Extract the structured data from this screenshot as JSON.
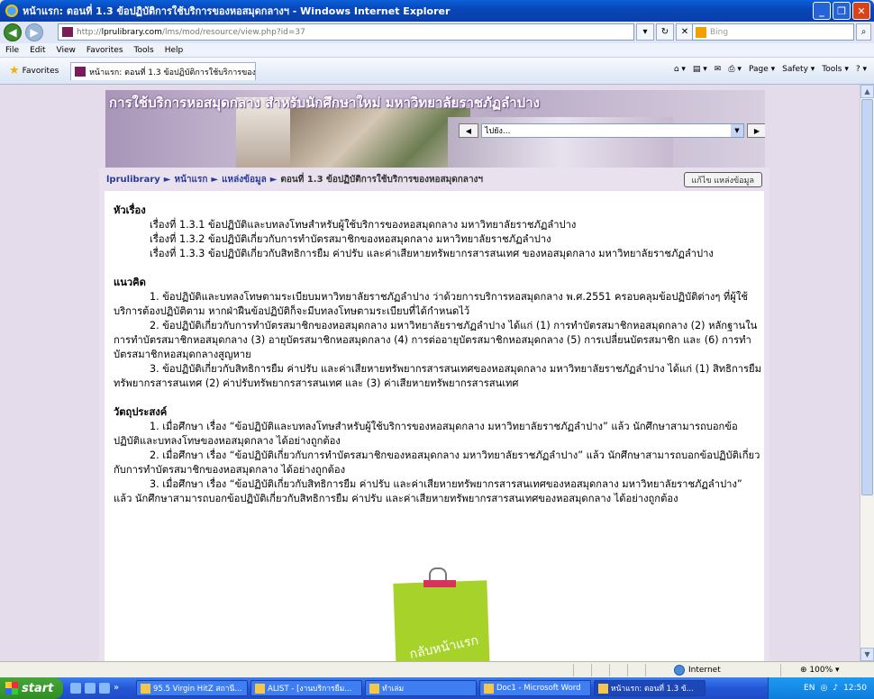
{
  "window": {
    "title": "หน้าแรก: ตอนที่ 1.3 ข้อปฏิบัติการใช้บริการของหอสมุดกลางฯ - Windows Internet Explorer"
  },
  "nav": {
    "url_prefix": "http://",
    "url_host": "lprulibrary.com",
    "url_path": "/lms/mod/resource/view.php?id=37",
    "search_placeholder": "Bing"
  },
  "menu": [
    "File",
    "Edit",
    "View",
    "Favorites",
    "Tools",
    "Help"
  ],
  "favorites": {
    "label": "Favorites",
    "tab_title": "หน้าแรก: ตอนที่ 1.3 ข้อปฏิบัติการใช้บริการของหอสมุด...",
    "commands": [
      "Page ▾",
      "Safety ▾",
      "Tools ▾"
    ]
  },
  "page": {
    "site_title": "การใช้บริการหอสมุดกลาง สำหรับนักศึกษาใหม่ มหาวิทยาลัยราชภัฏลำปาง",
    "jump_placeholder": "ไปยัง...",
    "breadcrumb": [
      "lprulibrary",
      "หน้าแรก",
      "แหล่งข้อมูล",
      "ตอนที่ 1.3 ข้อปฏิบัติการใช้บริการของหอสมุดกลางฯ"
    ],
    "edit_button": "แก้ไข แหล่งข้อมูล",
    "topics_heading": "หัวเรื่อง",
    "topics": [
      "เรื่องที่ 1.3.1 ข้อปฏิบัติและบทลงโทษสำหรับผู้ใช้บริการของหอสมุดกลาง มหาวิทยาลัยราชภัฏลำปาง",
      "เรื่องที่ 1.3.2 ข้อปฏิบัติเกี่ยวกับการทำบัตรสมาชิกของหอสมุดกลาง มหาวิทยาลัยราชภัฏลำปาง",
      "เรื่องที่ 1.3.3 ข้อปฏิบัติเกี่ยวกับสิทธิการยืม ค่าปรับ และค่าเสียหายทรัพยากรสารสนเทศ ของหอสมุดกลาง มหาวิทยาลัยราชภัฏลำปาง"
    ],
    "concept_heading": "แนวคิด",
    "concepts": [
      "1. ข้อปฏิบัติและบทลงโทษตามระเบียบมหาวิทยาลัยราชภัฏลำปาง ว่าด้วยการบริการหอสมุดกลาง พ.ศ.2551 ครอบคลุมข้อปฏิบัติต่างๆ ที่ผู้ใช้บริการต้องปฏิบัติตาม หากฝ่าฝืนข้อปฏิบัติก็จะมีบทลงโทษตามระเบียบที่ได้กำหนดไว้",
      "2. ข้อปฏิบัติเกี่ยวกับการทำบัตรสมาชิกของหอสมุดกลาง มหาวิทยาลัยราชภัฏลำปาง ได้แก่ (1) การทำบัตรสมาชิกหอสมุดกลาง (2) หลักฐานในการทำบัตรสมาชิกหอสมุดกลาง (3) อายุบัตรสมาชิกหอสมุดกลาง (4) การต่ออายุบัตรสมาชิกหอสมุดกลาง (5) การเปลี่ยนบัตรสมาชิก และ (6) การทำบัตรสมาชิกหอสมุดกลางสูญหาย",
      "3. ข้อปฏิบัติเกี่ยวกับสิทธิการยืม ค่าปรับ และค่าเสียหายทรัพยากรสารสนเทศของหอสมุดกลาง มหาวิทยาลัยราชภัฏลำปาง ได้แก่ (1) สิทธิการยืมทรัพยากรสารสนเทศ (2) ค่าปรับทรัพยากรสารสนเทศ และ (3) ค่าเสียหายทรัพยากรสารสนเทศ"
    ],
    "objective_heading": "วัตถุประสงค์",
    "objectives": [
      "1. เมื่อศึกษา เรื่อง “ข้อปฏิบัติและบทลงโทษสำหรับผู้ใช้บริการของหอสมุดกลาง มหาวิทยาลัยราชภัฏลำปาง” แล้ว นักศึกษาสามารถบอกข้อปฏิบัติและบทลงโทษของหอสมุดกลาง ได้อย่างถูกต้อง",
      "2. เมื่อศึกษา เรื่อง “ข้อปฏิบัติเกี่ยวกับการทำบัตรสมาชิกของหอสมุดกลาง มหาวิทยาลัยราชภัฏลำปาง” แล้ว นักศึกษาสามารถบอกข้อปฏิบัติเกี่ยวกับการทำบัตรสมาชิกของหอสมุดกลาง ได้อย่างถูกต้อง",
      "3. เมื่อศึกษา เรื่อง “ข้อปฏิบัติเกี่ยวกับสิทธิการยืม ค่าปรับ และค่าเสียหายทรัพยากรสารสนเทศของหอสมุดกลาง มหาวิทยาลัยราชภัฏลำปาง” แล้ว นักศึกษาสามารถบอกข้อปฏิบัติเกี่ยวกับสิทธิการยืม ค่าปรับ และค่าเสียหายทรัพยากรสารสนเทศของหอสมุดกลาง ได้อย่างถูกต้อง"
    ],
    "home_note": "กลับหน้าแรก"
  },
  "status": {
    "zone": "Internet",
    "zoom": "100%"
  },
  "taskbar": {
    "start": "start",
    "tasks": [
      {
        "label": "95.5 Virgin HitZ สถานี...",
        "active": false
      },
      {
        "label": "ALIST - [งานบริการยืม...",
        "active": false
      },
      {
        "label": "ทำเล่ม",
        "active": false
      },
      {
        "label": "Doc1 - Microsoft Word",
        "active": false
      },
      {
        "label": "หน้าแรก: ตอนที่ 1.3 ข้...",
        "active": true
      }
    ],
    "lang": "EN",
    "clock": "12:50"
  }
}
